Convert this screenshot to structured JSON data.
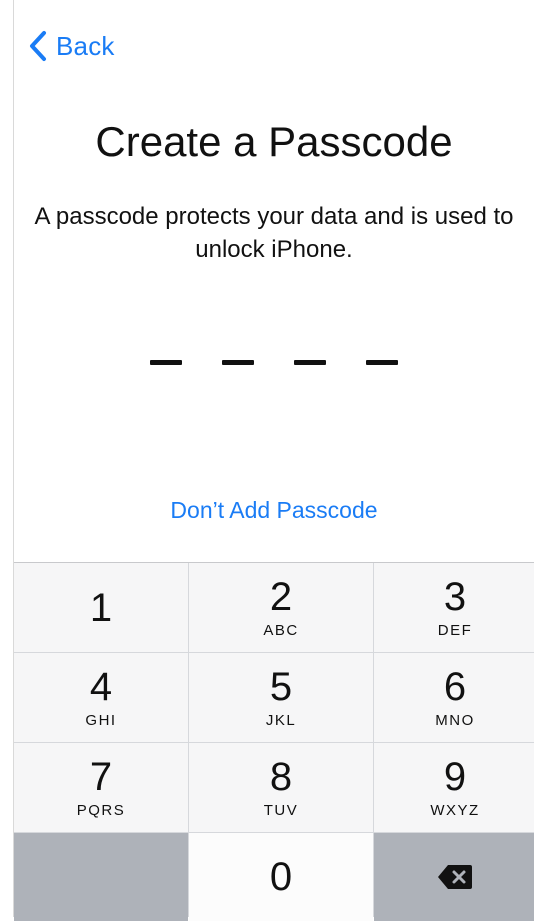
{
  "nav": {
    "back_label": "Back"
  },
  "title": "Create a Passcode",
  "subtitle": "A passcode protects your data and is used to unlock iPhone.",
  "passcode_length": 4,
  "skip_label": "Don’t Add Passcode",
  "keypad": {
    "keys": [
      {
        "digit": "1",
        "letters": ""
      },
      {
        "digit": "2",
        "letters": "ABC"
      },
      {
        "digit": "3",
        "letters": "DEF"
      },
      {
        "digit": "4",
        "letters": "GHI"
      },
      {
        "digit": "5",
        "letters": "JKL"
      },
      {
        "digit": "6",
        "letters": "MNO"
      },
      {
        "digit": "7",
        "letters": "PQRS"
      },
      {
        "digit": "8",
        "letters": "TUV"
      },
      {
        "digit": "9",
        "letters": "WXYZ"
      }
    ],
    "zero": {
      "digit": "0"
    },
    "delete_icon": "delete-backspace-icon"
  },
  "colors": {
    "accent": "#1a7cf5",
    "keypad_bg": "#d6d8dc",
    "key_bg": "#f6f6f7",
    "key_dark_bg": "#aeb2b9"
  }
}
